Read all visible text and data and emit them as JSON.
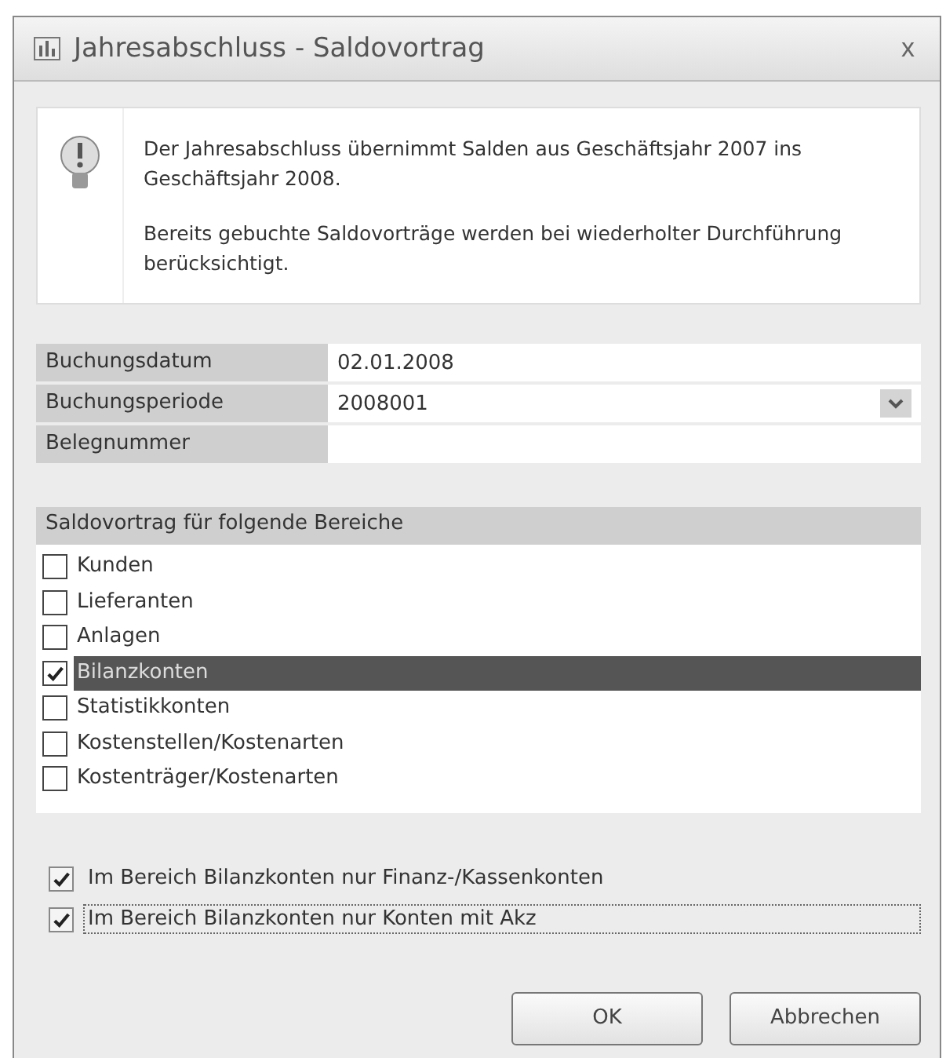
{
  "window": {
    "title": "Jahresabschluss - Saldovortrag",
    "close": "x"
  },
  "info": {
    "lines": [
      "Der Jahresabschluss übernimmt Salden aus Geschäftsjahr 2007 ins Geschäftsjahr 2008.",
      "Bereits gebuchte Saldovorträge werden bei wiederholter Durchführung berücksichtigt."
    ]
  },
  "fields": [
    {
      "label": "Buchungsdatum",
      "value": "02.01.2008",
      "kind": "text"
    },
    {
      "label": "Buchungsperiode",
      "value": "2008001",
      "kind": "dropdown"
    },
    {
      "label": "Belegnummer",
      "kind": "text"
    }
  ],
  "areas": {
    "header": "Saldovortrag für folgende Bereiche",
    "items": [
      {
        "label": "Kunden",
        "checked": false,
        "selected": false
      },
      {
        "label": "Lieferanten",
        "checked": false,
        "selected": false
      },
      {
        "label": "Anlagen",
        "checked": false,
        "selected": false
      },
      {
        "label": "Bilanzkonten",
        "checked": true,
        "selected": true
      },
      {
        "label": "Statistikkonten",
        "checked": false,
        "selected": false
      },
      {
        "label": "Kostenstellen/Kostenarten",
        "checked": false,
        "selected": false
      },
      {
        "label": "Kostenträger/Kostenarten",
        "checked": false,
        "selected": false
      }
    ]
  },
  "options": [
    {
      "label": "Im Bereich Bilanzkonten nur Finanz-/Kassenkonten",
      "checked": true,
      "focused": false
    },
    {
      "label": "Im Bereich Bilanzkonten nur Konten mit Akz",
      "checked": true,
      "focused": true
    }
  ],
  "buttons": [
    "OK",
    "Abbrechen"
  ]
}
